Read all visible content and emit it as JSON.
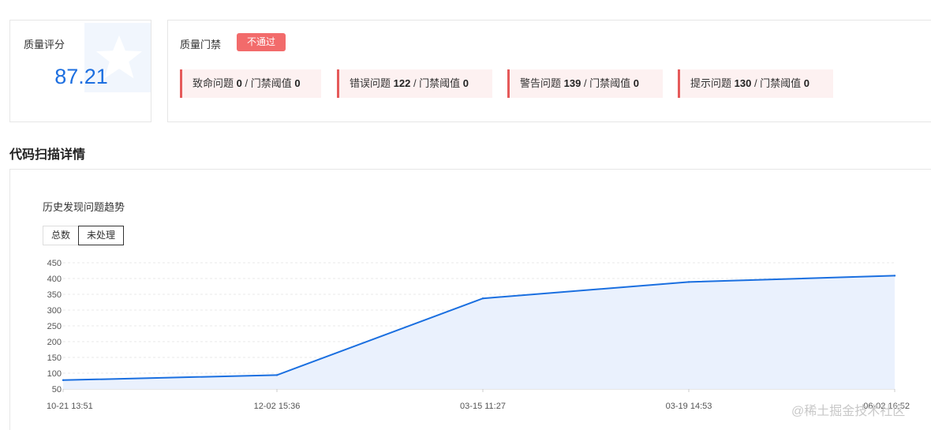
{
  "quality_score": {
    "label": "质量评分",
    "value": "87.21"
  },
  "quality_gate": {
    "label": "质量门禁",
    "status": "不通过",
    "status_color": "#f26b6b",
    "issues": [
      {
        "prefix": "致命问题 ",
        "count": "0",
        "sep": " / 门禁阈值 ",
        "threshold": "0"
      },
      {
        "prefix": "错误问题 ",
        "count": "122",
        "sep": " / 门禁阈值 ",
        "threshold": "0"
      },
      {
        "prefix": "警告问题 ",
        "count": "139",
        "sep": " / 门禁阈值 ",
        "threshold": "0"
      },
      {
        "prefix": "提示问题 ",
        "count": "130",
        "sep": " / 门禁阈值 ",
        "threshold": "0"
      }
    ]
  },
  "section_title": "代码扫描详情",
  "trend": {
    "title": "历史发现问题趋势",
    "tabs": [
      {
        "label": "总数",
        "active": false
      },
      {
        "label": "未处理",
        "active": true
      }
    ]
  },
  "chart_data": {
    "type": "area",
    "x": [
      "10-21 13:51",
      "12-02 15:36",
      "03-15 11:27",
      "03-19 14:53",
      "06-02 16:52"
    ],
    "series": [
      {
        "values": [
          78,
          94,
          337,
          389,
          409
        ]
      }
    ],
    "yticks": [
      50,
      100,
      150,
      200,
      250,
      300,
      350,
      400,
      450
    ],
    "ylim": [
      50,
      450
    ],
    "grid": true,
    "line_color": "#1a6fe0",
    "fill_color": "#eaf1fd"
  },
  "watermark": "@稀土掘金技术社区",
  "colors": {
    "accent": "#1d6fe0",
    "danger": "#e55a5a"
  }
}
